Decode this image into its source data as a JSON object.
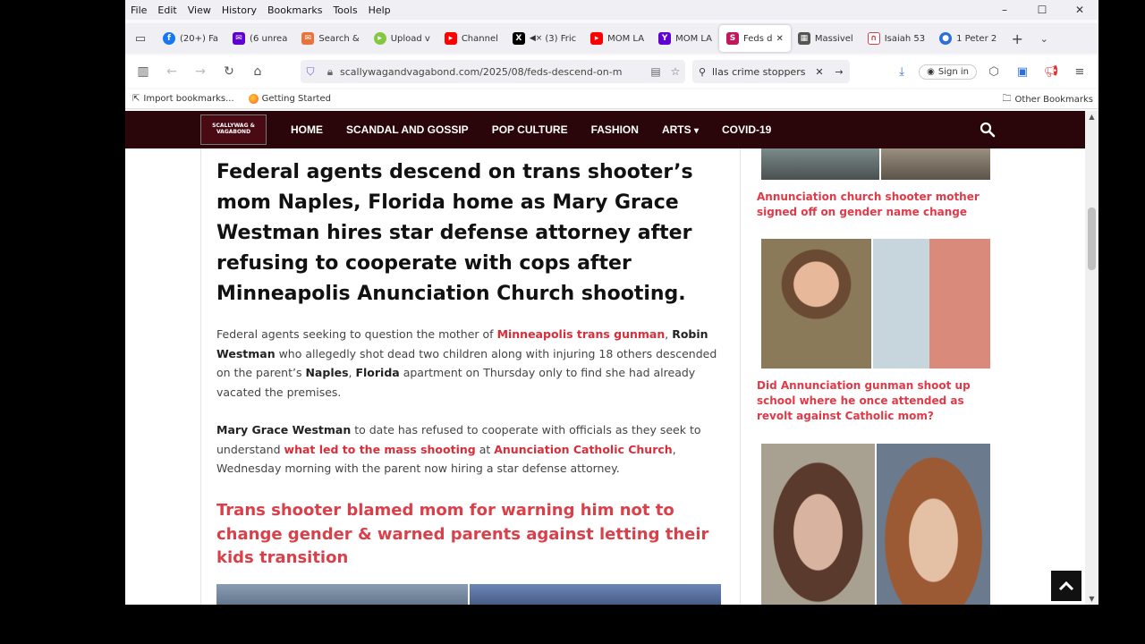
{
  "menubar": {
    "items": [
      "File",
      "Edit",
      "View",
      "History",
      "Bookmarks",
      "Tools",
      "Help"
    ]
  },
  "tabs": [
    {
      "label": "(20+) Fa",
      "icon": "facebook-icon",
      "color": "#1877f2"
    },
    {
      "label": "(6 unrea",
      "icon": "yahoo-mail-icon",
      "color": "#5f01d1"
    },
    {
      "label": "Search &",
      "icon": "search-mail-icon",
      "color": "#e8743b"
    },
    {
      "label": "Upload v",
      "icon": "rumble-icon",
      "color": "#85c742"
    },
    {
      "label": "Channel",
      "icon": "youtube-icon",
      "color": "#ff0000"
    },
    {
      "label": "(3) Fric",
      "icon": "x-icon",
      "color": "#000000"
    },
    {
      "label": "MOM LA",
      "icon": "youtube-icon",
      "color": "#ff0000"
    },
    {
      "label": "MOM LA",
      "icon": "yahoo-icon",
      "color": "#5f01d1"
    },
    {
      "label": "Feds d",
      "icon": "site-icon",
      "color": "#c2185b",
      "active": true
    },
    {
      "label": "Massivel",
      "icon": "site-icon",
      "color": "#555555"
    },
    {
      "label": "Isaiah 53",
      "icon": "site-icon",
      "color": "#d04050"
    },
    {
      "label": "1 Peter 2",
      "icon": "site-icon",
      "color": "#2e6fd6"
    }
  ],
  "nav": {
    "url": "scallywagandvagabond.com/2025/08/feds-descend-on-m",
    "search_value": "llas crime stoppers",
    "signin_label": "Sign in"
  },
  "bookmarks": {
    "import_label": "Import bookmarks...",
    "getting_started_label": "Getting Started",
    "other_label": "Other Bookmarks"
  },
  "site": {
    "logo_text": "SCALLYWAG & VAGABOND",
    "nav": [
      "HOME",
      "SCANDAL AND GOSSIP",
      "POP CULTURE",
      "FASHION",
      "ARTS",
      "COVID-19"
    ],
    "arts_caret": "▾"
  },
  "article": {
    "headline": "Federal agents descend on trans shooter’s mom Naples, Florida home as Mary Grace Westman hires star defense attorney after refusing to cooperate with cops after Minneapolis Anunciation Church shooting.",
    "p1": {
      "t1": "Federal agents seeking to question the mother of ",
      "link1": "Minneapolis trans gunman",
      "t2": ", ",
      "b1": "Robin Westman",
      "t3": " who allegedly shot dead two children along with injuring 18 others descended on the parent’s ",
      "b2": "Naples",
      "t4": ", ",
      "b3": "Florida",
      "t5": " apartment on Thursday only to find she had already vacated the premises."
    },
    "p2": {
      "b1": "Mary Grace Westman",
      "t1": " to date has refused to cooperate with officials as they seek to understand ",
      "link1": "what led to the mass shooting",
      "t2": " at ",
      "link2": "Anunciation Catholic Church",
      "t3": ", Wednesday morning with the parent now hiring a star defense attorney."
    },
    "subhead": "Trans shooter blamed mom for warning him not to change gender & warned parents against letting their kids transition"
  },
  "sidebar": {
    "link1": "Annunciation church shooter mother signed off on gender name change",
    "link2": "Did Annunciation gunman shoot up school where he once attended as revolt against Catholic mom?"
  },
  "colors": {
    "accent": "#d92e3a",
    "header_bg": "#2a0509"
  }
}
